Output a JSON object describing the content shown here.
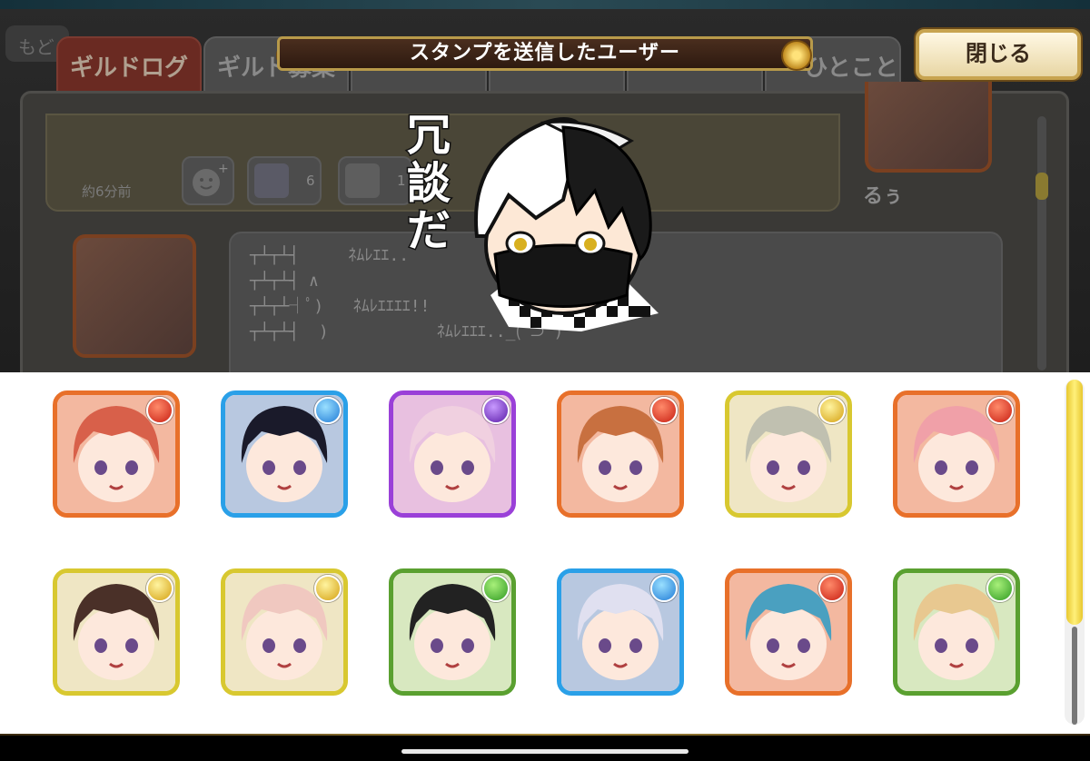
{
  "background": {
    "back_label": "もど",
    "tabs": [
      {
        "label": "ギルドログ",
        "active": true
      },
      {
        "label": "ギルド募集",
        "active": false
      },
      {
        "label": "",
        "active": false
      },
      {
        "label": "",
        "active": false
      },
      {
        "label": "",
        "active": false
      },
      {
        "label": "ひとこと",
        "active": false
      }
    ],
    "message_time": "約6分前",
    "reactions": [
      {
        "icon": "add-reaction-icon",
        "count": ""
      },
      {
        "icon": "stamp-thumbnail",
        "count": "6"
      },
      {
        "icon": "stamp-thumbnail",
        "count": "1"
      }
    ],
    "user_name": "るぅ",
    "ascii_art": "┬┴┬┴┤     ﾈﾑﾚｴｴ..\n┬┴┬┴┤ ∧\n┬┴┬┴┤ﾟ)   ﾈﾑﾚｴｴｴｴ!!\n┬┴┬┴┤  )           ﾈﾑﾚｴｴｴ.._(ﾟ⊃ﾟ)"
  },
  "header": {
    "title": "スタンプを送信したユーザー",
    "close_label": "閉じる"
  },
  "stamp": {
    "caption": "冗談だ"
  },
  "users": [
    {
      "attribute": "fire",
      "color": "#e8702a"
    },
    {
      "attribute": "water",
      "color": "#2aa0e8"
    },
    {
      "attribute": "dark",
      "color": "#9a40d8"
    },
    {
      "attribute": "fire",
      "color": "#e8702a"
    },
    {
      "attribute": "light",
      "color": "#d8c830"
    },
    {
      "attribute": "fire",
      "color": "#e8702a"
    },
    {
      "attribute": "light",
      "color": "#d8c830"
    },
    {
      "attribute": "light",
      "color": "#d8c830"
    },
    {
      "attribute": "wood",
      "color": "#5aa030"
    },
    {
      "attribute": "water",
      "color": "#2aa0e8"
    },
    {
      "attribute": "fire",
      "color": "#e8702a"
    },
    {
      "attribute": "wood",
      "color": "#5aa030"
    }
  ]
}
